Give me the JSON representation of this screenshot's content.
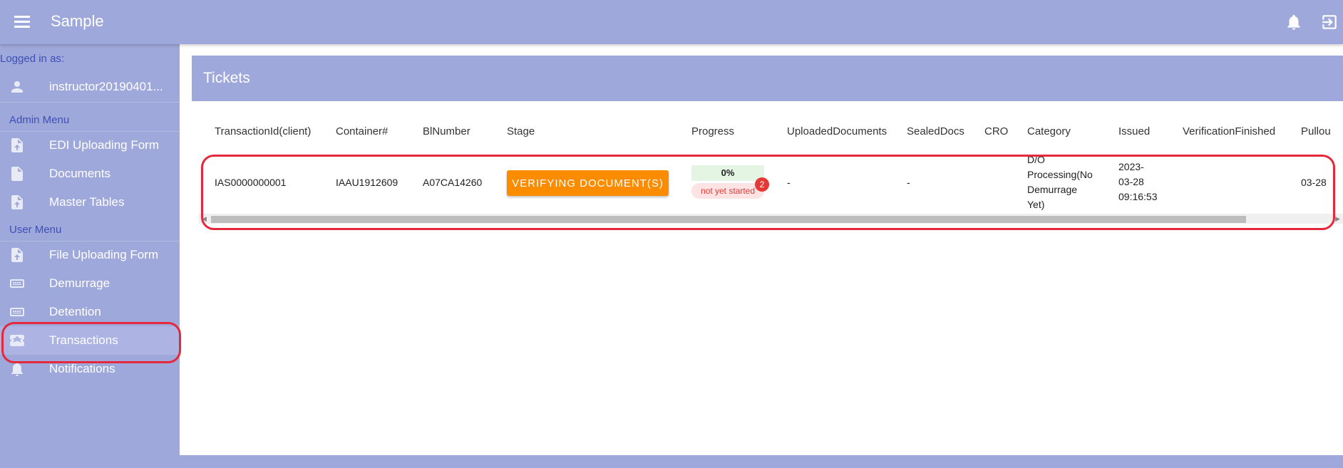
{
  "app": {
    "title": "Sample"
  },
  "topbar": {
    "icons": [
      "menu-icon",
      "bell-icon",
      "logout-icon"
    ]
  },
  "sidebar": {
    "logged_in_label": "Logged in as:",
    "user": {
      "name": "instructor20190401...",
      "icon": "person-icon"
    },
    "admin_menu_label": "Admin Menu",
    "admin_items": [
      {
        "label": "EDI Uploading Form",
        "icon": "file-upload-icon"
      },
      {
        "label": "Documents",
        "icon": "document-icon"
      },
      {
        "label": "Master Tables",
        "icon": "file-upload-icon"
      }
    ],
    "user_menu_label": "User Menu",
    "user_items": [
      {
        "label": "File Uploading Form",
        "icon": "file-upload-icon"
      },
      {
        "label": "Demurrage",
        "icon": "keyboard-icon"
      },
      {
        "label": "Detention",
        "icon": "keyboard-icon"
      },
      {
        "label": "Transactions",
        "icon": "ticket-icon",
        "active": true
      },
      {
        "label": "Notifications",
        "icon": "bell-icon"
      }
    ]
  },
  "tickets": {
    "title": "Tickets",
    "columns": [
      "TransactionId(client)",
      "Container#",
      "BlNumber",
      "Stage",
      "Progress",
      "UploadedDocuments",
      "SealedDocs",
      "CRO",
      "Category",
      "Issued",
      "VerificationFinished",
      "Pullou"
    ],
    "row": {
      "transaction_id": "IAS0000000001",
      "container": "IAAU1912609",
      "bl_number": "A07CA14260",
      "stage": "VERIFYING DOCUMENT(S)",
      "progress": {
        "percent_label": "0%",
        "status": "not yet started",
        "badge": "2"
      },
      "uploaded_documents": "-",
      "sealed_docs": "-",
      "cro": "",
      "category_lines": [
        "D/O",
        "Processing(No",
        "Demurrage",
        "Yet)"
      ],
      "issued_lines": [
        "2023-",
        "03-28",
        "09:16:53"
      ],
      "verification_finished": "",
      "pullout": "03-28"
    }
  },
  "colors": {
    "primary": "#9fa8da",
    "stage_button": "#fb8c00",
    "highlight": "#e5283b",
    "badge": "#e53935"
  }
}
